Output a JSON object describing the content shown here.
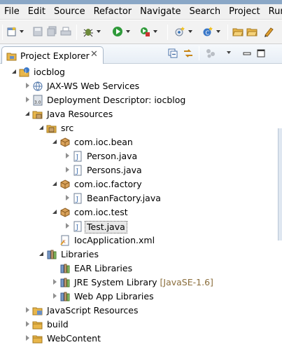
{
  "menubar": {
    "items": [
      "File",
      "Edit",
      "Source",
      "Refactor",
      "Navigate",
      "Search",
      "Project",
      "Run"
    ]
  },
  "tab": {
    "label": "Project Explorer",
    "close_glyph": "✕"
  },
  "tree": [
    {
      "label": "iocblog",
      "icon": "project-icon",
      "twisty": "open"
    },
    {
      "label": "JAX-WS Web Services",
      "icon": "webservices-icon",
      "twisty": "closed"
    },
    {
      "label": "Deployment Descriptor: iocblog",
      "icon": "deployment-icon",
      "twisty": "closed"
    },
    {
      "label": "Java Resources",
      "icon": "java-resources-icon",
      "twisty": "open"
    },
    {
      "label": "src",
      "icon": "source-folder-icon",
      "twisty": "open"
    },
    {
      "label": "com.ioc.bean",
      "icon": "package-icon",
      "twisty": "open"
    },
    {
      "label": "Person.java",
      "icon": "java-file-icon",
      "twisty": "closed"
    },
    {
      "label": "Persons.java",
      "icon": "java-file-icon",
      "twisty": "closed"
    },
    {
      "label": "com.ioc.factory",
      "icon": "package-icon",
      "twisty": "open"
    },
    {
      "label": "BeanFactory.java",
      "icon": "java-file-icon",
      "twisty": "closed"
    },
    {
      "label": "com.ioc.test",
      "icon": "package-icon",
      "twisty": "open"
    },
    {
      "label": "Test.java",
      "icon": "java-file-icon",
      "twisty": "closed",
      "selected": true
    },
    {
      "label": "IocApplication.xml",
      "icon": "xml-file-icon",
      "twisty": "none"
    },
    {
      "label": "Libraries",
      "icon": "libraries-icon",
      "twisty": "open"
    },
    {
      "label": "EAR Libraries",
      "icon": "library-icon",
      "twisty": "none"
    },
    {
      "label": "JRE System Library",
      "decoration": "[JavaSE-1.6]",
      "icon": "library-icon",
      "twisty": "closed"
    },
    {
      "label": "Web App Libraries",
      "icon": "library-icon",
      "twisty": "closed"
    },
    {
      "label": "JavaScript Resources",
      "icon": "javascript-resources-icon",
      "twisty": "closed"
    },
    {
      "label": "build",
      "icon": "folder-icon",
      "twisty": "closed"
    },
    {
      "label": "WebContent",
      "icon": "folder-icon",
      "twisty": "closed"
    }
  ]
}
